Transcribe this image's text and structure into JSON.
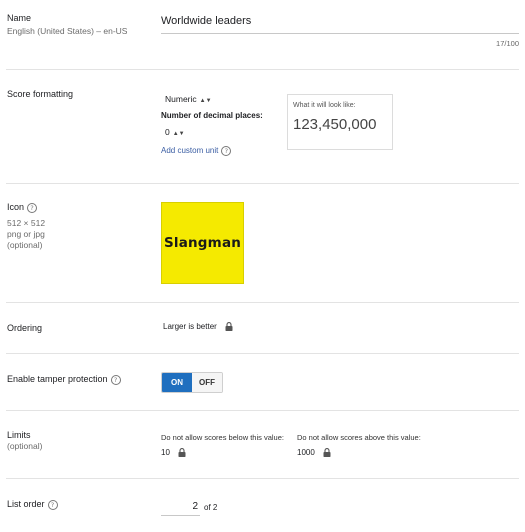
{
  "name": {
    "label": "Name",
    "locale": "English (United States) – en-US",
    "value": "Worldwide leaders",
    "char_count": "17/100"
  },
  "score_formatting": {
    "label": "Score formatting",
    "format_selected": "Numeric",
    "decimal_label": "Number of decimal places:",
    "decimal_selected": "0",
    "add_unit": "Add custom unit",
    "preview_title": "What it will look like:",
    "preview_value": "123,450,000"
  },
  "icon": {
    "label": "Icon",
    "size": "512 × 512",
    "format": "png or jpg",
    "optional": "(optional)",
    "image_text": "Slangman",
    "image_bg": "#f5ea00"
  },
  "ordering": {
    "label": "Ordering",
    "value": "Larger is better"
  },
  "tamper": {
    "label": "Enable tamper protection",
    "on_label": "ON",
    "off_label": "OFF",
    "state": "on",
    "accent": "#1f6fbf"
  },
  "limits": {
    "label": "Limits",
    "optional": "(optional)",
    "below_label": "Do not allow scores below this value:",
    "below_value": "10",
    "above_label": "Do not allow scores above this value:",
    "above_value": "1000"
  },
  "list_order": {
    "label": "List order",
    "value": "2",
    "total": "of 2"
  }
}
